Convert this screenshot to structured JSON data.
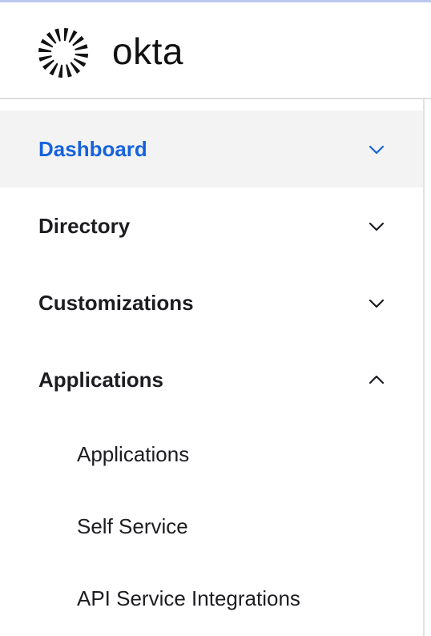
{
  "brand": {
    "name": "okta",
    "logo_icon": "okta-sunburst-icon"
  },
  "colors": {
    "accent": "#1662dd",
    "text": "#1d1d21",
    "active_bg": "#f3f3f3",
    "divider": "#e2e2e2"
  },
  "sidebar": {
    "items": [
      {
        "label": "Dashboard",
        "active": true,
        "expanded": false,
        "icon": "chevron-down-icon"
      },
      {
        "label": "Directory",
        "active": false,
        "expanded": false,
        "icon": "chevron-down-icon"
      },
      {
        "label": "Customizations",
        "active": false,
        "expanded": false,
        "icon": "chevron-down-icon"
      },
      {
        "label": "Applications",
        "active": false,
        "expanded": true,
        "icon": "chevron-up-icon",
        "children": [
          {
            "label": "Applications"
          },
          {
            "label": "Self Service"
          },
          {
            "label": "API Service Integrations"
          }
        ]
      }
    ]
  }
}
